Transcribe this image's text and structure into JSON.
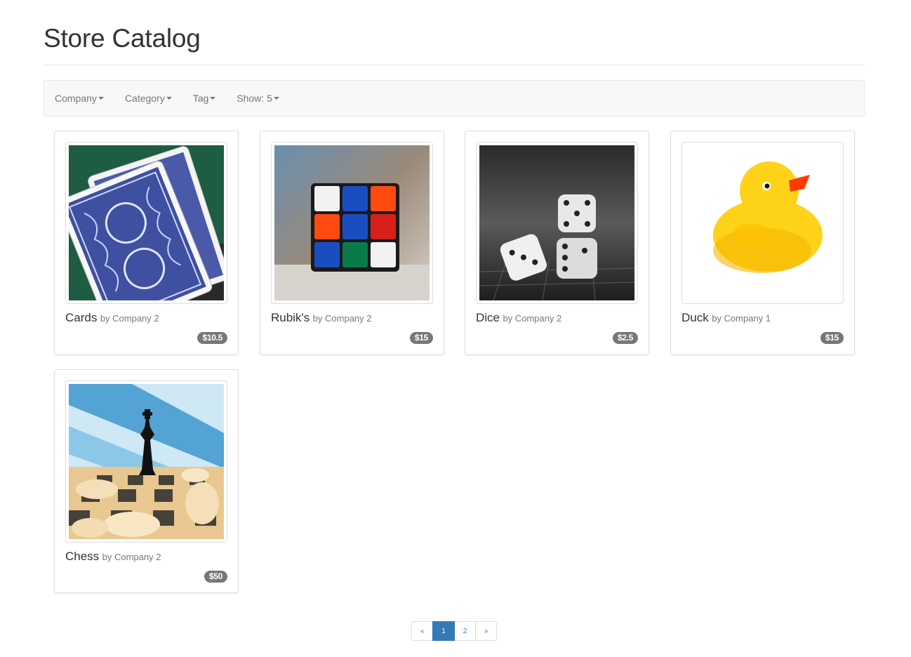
{
  "page": {
    "title": "Store Catalog"
  },
  "filters": [
    {
      "label": "Company"
    },
    {
      "label": "Category"
    },
    {
      "label": "Tag"
    },
    {
      "label": "Show: 5"
    }
  ],
  "products": [
    {
      "name": "Cards",
      "company": "by Company 2",
      "price": "$10.5",
      "image": "playing-cards-image"
    },
    {
      "name": "Rubik's",
      "company": "by Company 2",
      "price": "$15",
      "image": "rubiks-cube-image"
    },
    {
      "name": "Dice",
      "company": "by Company 2",
      "price": "$2.5",
      "image": "dice-image"
    },
    {
      "name": "Duck",
      "company": "by Company 1",
      "price": "$15",
      "image": "rubber-duck-image"
    },
    {
      "name": "Chess",
      "company": "by Company 2",
      "price": "$50",
      "image": "chess-image"
    }
  ],
  "pagination": {
    "prev": "«",
    "pages": [
      "1",
      "2"
    ],
    "active": "1",
    "next": "»"
  },
  "colors": {
    "accent": "#337ab7",
    "badge": "#777777",
    "navbar_bg": "#f8f8f8"
  }
}
